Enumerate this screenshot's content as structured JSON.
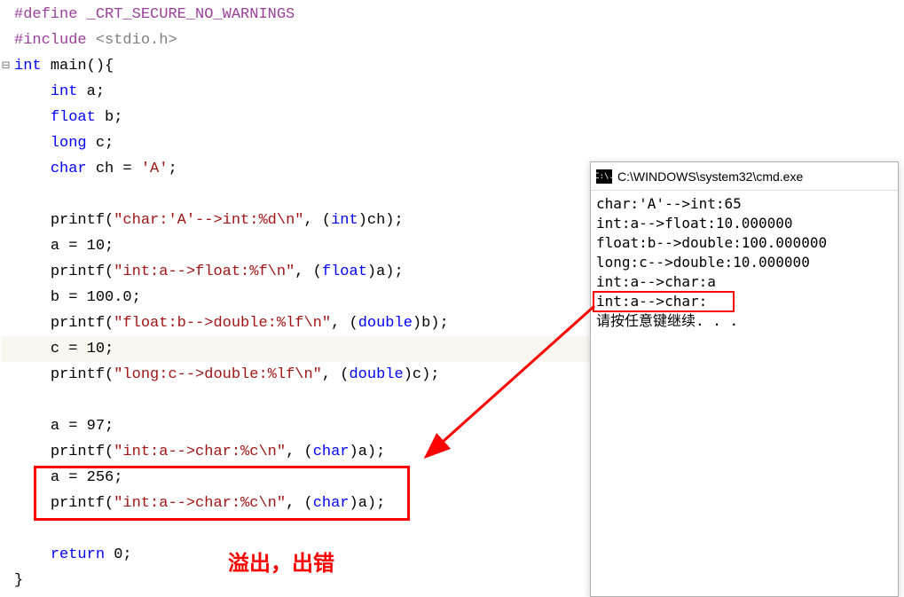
{
  "code": {
    "define": "#define",
    "define_sym": "_CRT_SECURE_NO_WARNINGS",
    "include": "#include",
    "include_path": "<stdio.h>",
    "int": "int",
    "main": "main",
    "parens_brace": "(){",
    "decl_int": "int",
    "decl_a": "a;",
    "decl_float": "float",
    "decl_b": "b;",
    "decl_long": "long",
    "decl_c": "c;",
    "decl_char": "char",
    "decl_ch": "ch = ",
    "char_A": "'A'",
    "semi": ";",
    "printf": "printf",
    "fmt1": "\"char:'A'-->int:%d\\n\"",
    "cast_int": "int",
    "arg_ch": "ch);",
    "a10": "a = 10;",
    "fmt2": "\"int:a-->float:%f\\n\"",
    "cast_float": "float",
    "arg_a": "a);",
    "b100": "b = 100.0;",
    "fmt3": "\"float:b-->double:%lf\\n\"",
    "cast_double": "double",
    "arg_b": "b);",
    "c10": "c = 10;",
    "fmt4": "\"long:c-->double:%lf\\n\"",
    "arg_c": "c);",
    "a97": "a = 97;",
    "fmt5": "\"int:a-->char:%c\\n\"",
    "cast_char": "char",
    "a256": "a = 256;",
    "return": "return",
    "zero": "0;",
    "close_brace": "}"
  },
  "console": {
    "title": "C:\\WINDOWS\\system32\\cmd.exe",
    "icon": "C:\\.",
    "line1": "char:'A'-->int:65",
    "line2": "int:a-->float:10.000000",
    "line3": "float:b-->double:100.000000",
    "line4": "long:c-->double:10.000000",
    "line5": "int:a-->char:a",
    "line6": "int:a-->char:",
    "line7": "请按任意键继续. . ."
  },
  "annotation": {
    "text": "溢出，出错"
  }
}
